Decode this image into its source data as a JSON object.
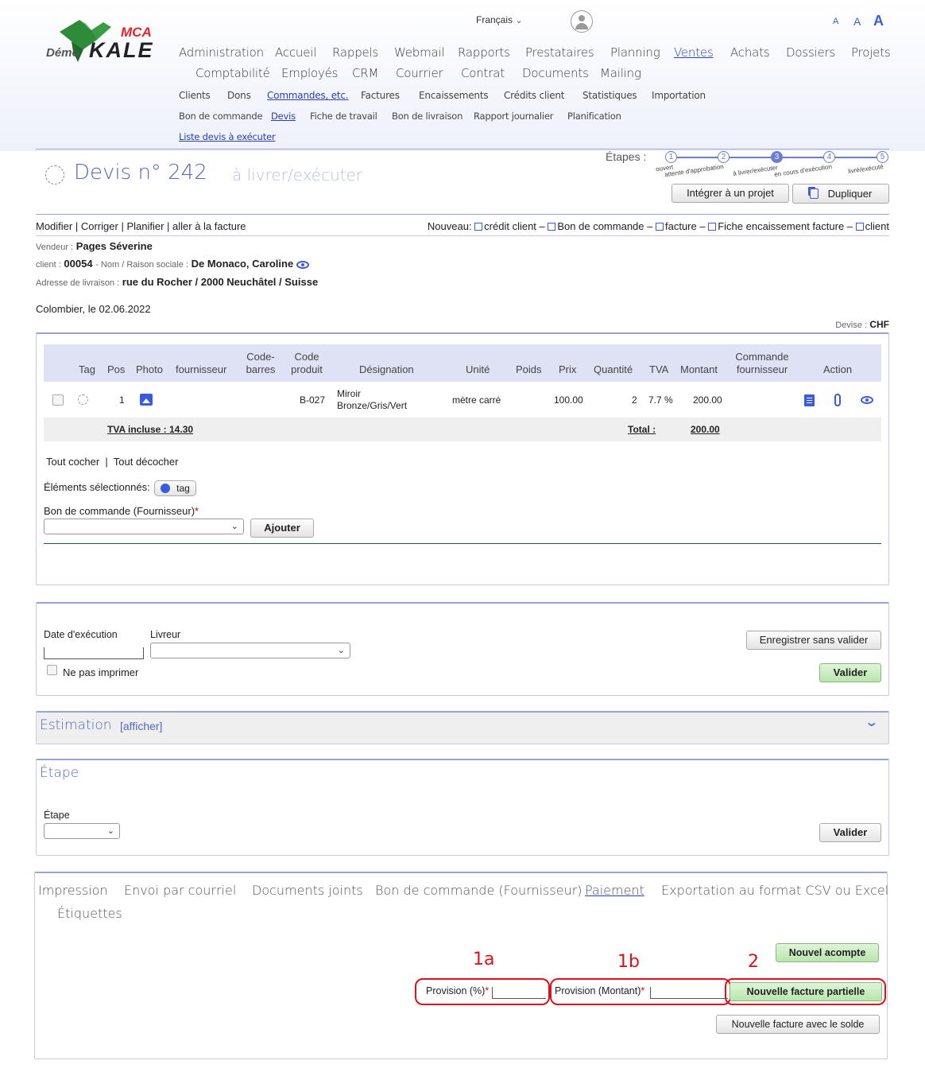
{
  "header": {
    "logo_demo": "Démo",
    "logo_brand": "KALE",
    "logo_brand2": "MCA",
    "language": "Français",
    "font_sizes": [
      "A",
      "A",
      "A"
    ]
  },
  "main_nav_row1": [
    "Administration",
    "Accueil",
    "Rappels",
    "Webmail",
    "Rapports",
    "Prestataires",
    "Planning",
    "Ventes",
    "Achats",
    "Dossiers",
    "Projets"
  ],
  "main_nav_row2": [
    "Comptabilité",
    "Employés",
    "CRM",
    "Courrier",
    "Contrat",
    "Documents",
    "Mailing"
  ],
  "sub_nav": [
    "Clients",
    "Dons",
    "Commandes, etc.",
    "Factures",
    "Encaissements",
    "Crédits client",
    "Statistiques",
    "Importation"
  ],
  "sub_sub_nav": [
    "Bon de commande",
    "Devis",
    "Fiche de travail",
    "Bon de livraison",
    "Rapport journalier",
    "Planification"
  ],
  "sub_sub_sub_nav": "Liste devis à exécuter",
  "title": {
    "heading": "Devis n° 242",
    "status": "à livrer/exécuter"
  },
  "steps": {
    "label": "Étapes :",
    "items": [
      {
        "num": "1",
        "label": "ouvert"
      },
      {
        "num": "2",
        "label": "attente d'approbation"
      },
      {
        "num": "3",
        "label": "à livrer/exécuter"
      },
      {
        "num": "4",
        "label": "en cours d'exécution"
      },
      {
        "num": "5",
        "label": "livré/exécuté"
      }
    ]
  },
  "actions": {
    "integrate": "Intégrer à un projet",
    "duplicate": "Dupliquer"
  },
  "edit_links": [
    "Modifier",
    "Corriger",
    "Planifier",
    "aller à la facture"
  ],
  "new_links": {
    "label": "Nouveau:",
    "items": [
      "crédit client",
      "Bon de commande",
      "facture",
      "Fiche encaissement facture",
      "client"
    ]
  },
  "info": {
    "vendeur_label": "Vendeur :",
    "vendeur": "Pages Séverine",
    "client_label": "client :",
    "client_id": "00054",
    "nom_label": "- Nom / Raison sociale :",
    "client_name": "De Monaco, Caroline",
    "adresse_label": "Adresse de livraison :",
    "adresse": "rue du Rocher / 2000 Neuchâtel / Suisse",
    "date_line": "Colombier, le 02.06.2022",
    "devise_label": "Devise :",
    "devise": "CHF"
  },
  "table": {
    "headers": [
      "Tag",
      "Pos",
      "Photo",
      "fournisseur",
      "Code-barres",
      "Code produit",
      "Désignation",
      "Unité",
      "Poids",
      "Prix",
      "Quantité",
      "TVA",
      "Montant",
      "Commande fournisseur",
      "Action"
    ],
    "header_code_barres": [
      "Code-",
      "barres"
    ],
    "header_code_produit": [
      "Code",
      "produit"
    ],
    "header_commande": [
      "Commande",
      "fournisseur"
    ],
    "rows": [
      {
        "pos": "1",
        "code": "B-027",
        "designation1": "Miroir",
        "designation2": "Bronze/Gris/Vert",
        "unite": "mètre carré",
        "prix": "100.00",
        "quantite": "2",
        "tva": "7.7 %",
        "montant": "200.00"
      }
    ],
    "tva_incluse": "TVA incluse : 14.30",
    "total_label": "Total :",
    "total": "200.00"
  },
  "selection": {
    "check_all": "Tout cocher",
    "uncheck_all": "Tout décocher",
    "selected_label": "Éléments sélectionnés:",
    "tag_button": "tag",
    "po_label": "Bon de commande (Fournisseur)",
    "add_button": "Ajouter"
  },
  "execution": {
    "date_label": "Date d'exécution",
    "livreur_label": "Livreur",
    "no_print": "Ne pas imprimer",
    "save_button": "Enregistrer sans valider",
    "validate_button": "Valider"
  },
  "estimation": {
    "title": "Estimation",
    "show": "[afficher]"
  },
  "etape": {
    "title": "Étape",
    "label": "Étape",
    "validate_button": "Valider"
  },
  "tabs": {
    "items": [
      "Impression",
      "Envoi par courriel",
      "Documents joints",
      "Bon de commande (Fournisseur)",
      "Paiement",
      "Exportation au format CSV ou Excel",
      "Étiquettes"
    ],
    "active": "Paiement"
  },
  "payment": {
    "deposit_button": "Nouvel acompte",
    "provision_pct_label": "Provision (%)",
    "provision_amt_label": "Provision (Montant)",
    "partial_invoice_button": "Nouvelle facture partielle",
    "balance_invoice_button": "Nouvelle facture avec le solde",
    "annotations": [
      "1a",
      "1b",
      "2"
    ]
  }
}
